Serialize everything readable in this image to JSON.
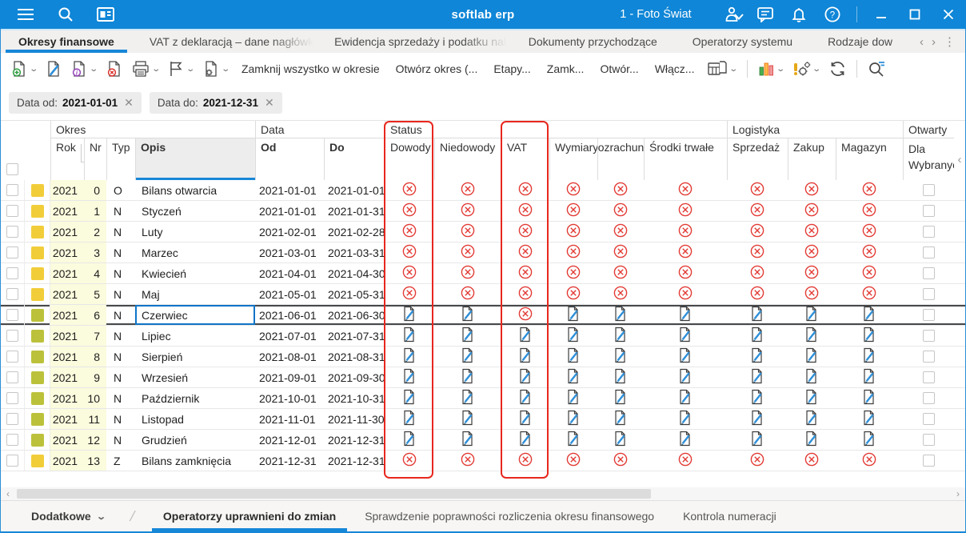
{
  "titlebar": {
    "app_title": "softlab erp",
    "company_selector": "1 - Foto Świat"
  },
  "tabbar": {
    "tabs": [
      {
        "label": "Okresy finansowe",
        "active": true
      },
      {
        "label": "VAT z deklaracją – dane nagłówkowe",
        "active": false
      },
      {
        "label": "Ewidencja sprzedaży i podatku należne",
        "active": false
      },
      {
        "label": "Dokumenty przychodzące",
        "active": false
      },
      {
        "label": "Operatorzy systemu",
        "active": false
      },
      {
        "label": "Rodzaje dow",
        "active": false
      }
    ]
  },
  "toolbar": {
    "text_buttons": [
      "Zamknij wszystko w okresie",
      "Otwórz okres (...",
      "Etapy...",
      "Zamk...",
      "Otwór...",
      "Włącz..."
    ]
  },
  "filters": [
    {
      "label": "Data od:",
      "value": "2021-01-01"
    },
    {
      "label": "Data do:",
      "value": "2021-12-31"
    }
  ],
  "table": {
    "groups": {
      "okres": "Okres",
      "data": "Data",
      "status": "Status",
      "logistyka": "Logistyka",
      "otwarty": "Otwarty"
    },
    "columns": {
      "rok": "Rok",
      "nr": "Nr",
      "typ": "Typ",
      "opis": "Opis",
      "od": "Od",
      "do": "Do",
      "dowody": "Dowody",
      "niedowody": "Niedowody",
      "vat": "VAT",
      "wymiary": "Wymiary",
      "rozrachunki": "Rozrachunki",
      "srodki_trwale": "Środki trwałe",
      "sprzedaz": "Sprzedaż",
      "zakup": "Zakup",
      "magazyn": "Magazyn",
      "dla_wybranych": "Dla Wybranych"
    },
    "sort": {
      "rok_order": "1",
      "nr_order": "2"
    },
    "rows": [
      {
        "rok": "2021",
        "nr": "0",
        "typ": "O",
        "opis": "Bilans otwarcia",
        "od": "2021-01-01",
        "do": "2021-01-01",
        "badge": "yellow",
        "selected": false,
        "status": [
          "closed",
          "closed",
          "closed",
          "closed",
          "closed",
          "closed",
          "closed",
          "closed",
          "closed"
        ],
        "otwarty_dla_wybranych": false
      },
      {
        "rok": "2021",
        "nr": "1",
        "typ": "N",
        "opis": "Styczeń",
        "od": "2021-01-01",
        "do": "2021-01-31",
        "badge": "yellow",
        "selected": false,
        "status": [
          "closed",
          "closed",
          "closed",
          "closed",
          "closed",
          "closed",
          "closed",
          "closed",
          "closed"
        ],
        "otwarty_dla_wybranych": false
      },
      {
        "rok": "2021",
        "nr": "2",
        "typ": "N",
        "opis": "Luty",
        "od": "2021-02-01",
        "do": "2021-02-28",
        "badge": "yellow",
        "selected": false,
        "status": [
          "closed",
          "closed",
          "closed",
          "closed",
          "closed",
          "closed",
          "closed",
          "closed",
          "closed"
        ],
        "otwarty_dla_wybranych": false
      },
      {
        "rok": "2021",
        "nr": "3",
        "typ": "N",
        "opis": "Marzec",
        "od": "2021-03-01",
        "do": "2021-03-31",
        "badge": "yellow",
        "selected": false,
        "status": [
          "closed",
          "closed",
          "closed",
          "closed",
          "closed",
          "closed",
          "closed",
          "closed",
          "closed"
        ],
        "otwarty_dla_wybranych": false
      },
      {
        "rok": "2021",
        "nr": "4",
        "typ": "N",
        "opis": "Kwiecień",
        "od": "2021-04-01",
        "do": "2021-04-30",
        "badge": "yellow",
        "selected": false,
        "status": [
          "closed",
          "closed",
          "closed",
          "closed",
          "closed",
          "closed",
          "closed",
          "closed",
          "closed"
        ],
        "otwarty_dla_wybranych": false
      },
      {
        "rok": "2021",
        "nr": "5",
        "typ": "N",
        "opis": "Maj",
        "od": "2021-05-01",
        "do": "2021-05-31",
        "badge": "yellow",
        "selected": false,
        "status": [
          "closed",
          "closed",
          "closed",
          "closed",
          "closed",
          "closed",
          "closed",
          "closed",
          "closed"
        ],
        "otwarty_dla_wybranych": false
      },
      {
        "rok": "2021",
        "nr": "6",
        "typ": "N",
        "opis": "Czerwiec",
        "od": "2021-06-01",
        "do": "2021-06-30",
        "badge": "olive",
        "selected": true,
        "status": [
          "open",
          "open",
          "closed",
          "open",
          "open",
          "open",
          "open",
          "open",
          "open"
        ],
        "otwarty_dla_wybranych": false
      },
      {
        "rok": "2021",
        "nr": "7",
        "typ": "N",
        "opis": "Lipiec",
        "od": "2021-07-01",
        "do": "2021-07-31",
        "badge": "olive",
        "selected": false,
        "status": [
          "open",
          "open",
          "open",
          "open",
          "open",
          "open",
          "open",
          "open",
          "open"
        ],
        "otwarty_dla_wybranych": false
      },
      {
        "rok": "2021",
        "nr": "8",
        "typ": "N",
        "opis": "Sierpień",
        "od": "2021-08-01",
        "do": "2021-08-31",
        "badge": "olive",
        "selected": false,
        "status": [
          "open",
          "open",
          "open",
          "open",
          "open",
          "open",
          "open",
          "open",
          "open"
        ],
        "otwarty_dla_wybranych": false
      },
      {
        "rok": "2021",
        "nr": "9",
        "typ": "N",
        "opis": "Wrzesień",
        "od": "2021-09-01",
        "do": "2021-09-30",
        "badge": "olive",
        "selected": false,
        "status": [
          "open",
          "open",
          "open",
          "open",
          "open",
          "open",
          "open",
          "open",
          "open"
        ],
        "otwarty_dla_wybranych": false
      },
      {
        "rok": "2021",
        "nr": "10",
        "typ": "N",
        "opis": "Październik",
        "od": "2021-10-01",
        "do": "2021-10-31",
        "badge": "olive",
        "selected": false,
        "status": [
          "open",
          "open",
          "open",
          "open",
          "open",
          "open",
          "open",
          "open",
          "open"
        ],
        "otwarty_dla_wybranych": false
      },
      {
        "rok": "2021",
        "nr": "11",
        "typ": "N",
        "opis": "Listopad",
        "od": "2021-11-01",
        "do": "2021-11-30",
        "badge": "olive",
        "selected": false,
        "status": [
          "open",
          "open",
          "open",
          "open",
          "open",
          "open",
          "open",
          "open",
          "open"
        ],
        "otwarty_dla_wybranych": false
      },
      {
        "rok": "2021",
        "nr": "12",
        "typ": "N",
        "opis": "Grudzień",
        "od": "2021-12-01",
        "do": "2021-12-31",
        "badge": "olive",
        "selected": false,
        "status": [
          "open",
          "open",
          "open",
          "open",
          "open",
          "open",
          "open",
          "open",
          "open"
        ],
        "otwarty_dla_wybranych": false
      },
      {
        "rok": "2021",
        "nr": "13",
        "typ": "Z",
        "opis": "Bilans zamknięcia",
        "od": "2021-12-31",
        "do": "2021-12-31",
        "badge": "yellow",
        "selected": false,
        "status": [
          "closed",
          "closed",
          "closed",
          "closed",
          "closed",
          "closed",
          "closed",
          "closed",
          "closed"
        ],
        "otwarty_dla_wybranych": false
      }
    ]
  },
  "annotations": {
    "highlight_color": "#E8271E",
    "highlighted_columns": [
      "Status / Dowody",
      "VAT"
    ]
  },
  "colors": {
    "titlebar": "#0F86D7",
    "accent": "#1787D8",
    "badge_yellow": "#F2CD3A",
    "badge_olive": "#BCC13B",
    "status_closed_red": "#E23B35",
    "status_open_blue": "#2E8FD8"
  },
  "footer": {
    "menu_label": "Dodatkowe",
    "tabs": [
      {
        "label": "Operatorzy uprawnieni do zmian",
        "active": true
      },
      {
        "label": "Sprawdzenie poprawności rozliczenia okresu finansowego",
        "active": false
      },
      {
        "label": "Kontrola numeracji",
        "active": false
      }
    ]
  }
}
